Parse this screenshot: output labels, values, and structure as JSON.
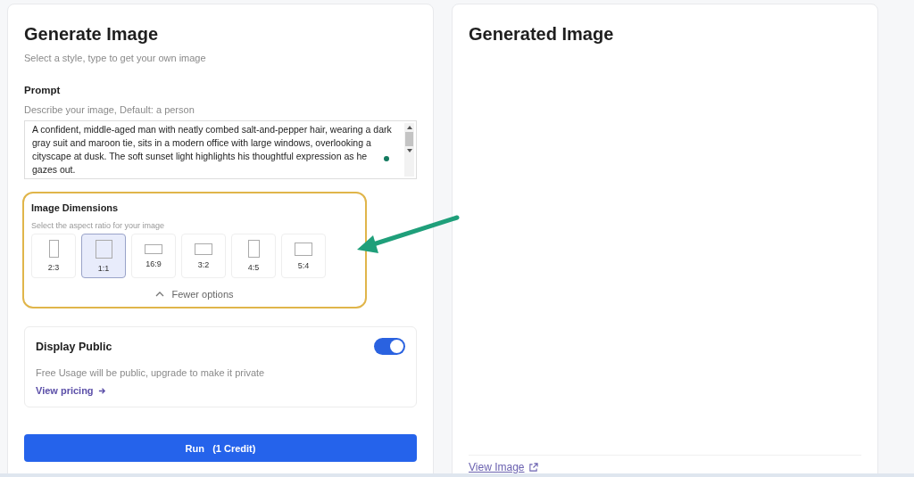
{
  "generate": {
    "title": "Generate Image",
    "subtitle": "Select a style, type to get your own image",
    "prompt": {
      "label": "Prompt",
      "hint": "Describe your image, Default: a person",
      "value": "A confident, middle-aged man with neatly combed salt-and-pepper hair, wearing a dark gray suit and maroon tie, sits in a modern office with large windows, overlooking a cityscape at dusk. The soft sunset light highlights his thoughtful expression as he gazes out."
    },
    "dimensions": {
      "title": "Image Dimensions",
      "subtitle": "Select the aspect ratio for your image",
      "options": [
        {
          "label": "2:3",
          "selected": false
        },
        {
          "label": "1:1",
          "selected": true
        },
        {
          "label": "16:9",
          "selected": false
        },
        {
          "label": "3:2",
          "selected": false
        },
        {
          "label": "4:5",
          "selected": false
        },
        {
          "label": "5:4",
          "selected": false
        }
      ],
      "toggle_label": "Fewer options",
      "expanded": true
    },
    "display_public": {
      "title": "Display Public",
      "on": true,
      "note": "Free Usage will be public, upgrade to make it private",
      "link": "View pricing"
    },
    "run_button": "Run   (1 Credit)"
  },
  "result": {
    "title": "Generated Image",
    "link": "View Image"
  }
}
